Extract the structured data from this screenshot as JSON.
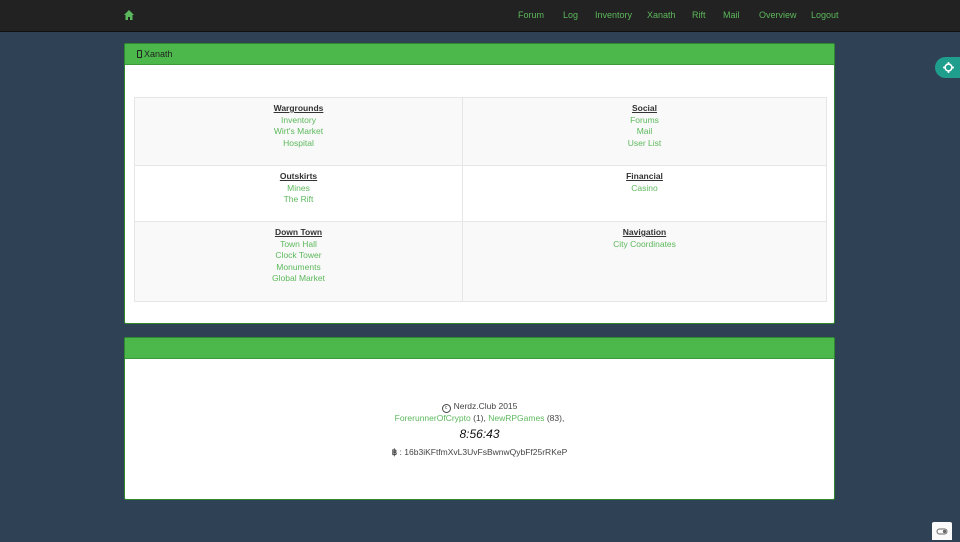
{
  "nav": {
    "home_icon": "home-icon",
    "links": [
      "Forum",
      "Log",
      "Inventory",
      "Xanath",
      "Rift",
      "Mail",
      "Overview",
      "Logout"
    ]
  },
  "panel1": {
    "title": "Xanath",
    "title_icon": "mobile-icon",
    "sections": [
      {
        "title": "Wargrounds",
        "links": [
          "Inventory",
          "Wirt's Market",
          "Hospital"
        ]
      },
      {
        "title": "Social",
        "links": [
          "Forums",
          "Mail",
          "User List"
        ]
      },
      {
        "title": "Outskirts",
        "links": [
          "Mines",
          "The Rift"
        ]
      },
      {
        "title": "Financial",
        "links": [
          "Casino"
        ]
      },
      {
        "title": "Down Town",
        "links": [
          "Town Hall",
          "Clock Tower",
          "Monuments",
          "Global Market"
        ]
      },
      {
        "title": "Navigation",
        "links": [
          "City Coordinates"
        ]
      }
    ]
  },
  "footer": {
    "copyright_icon": "copyright-icon",
    "copyright": "Nerdz.Club 2015",
    "users": [
      {
        "name": "ForerunnerOfCrypto",
        "count": "(1),"
      },
      {
        "name": "NewRPGames",
        "count": "(83),"
      }
    ],
    "clock": "8:56:43",
    "btc_icon": "bitcoin-icon",
    "btc_symbol": "฿",
    "btc_separator": ":",
    "btc_address": "16b3iKFtfmXvL3UvFsBwnwQybFf25rRKeP"
  },
  "colors": {
    "link": "#5cb85c",
    "panel_heading": "#4cb84c",
    "navbar": "#222222",
    "background": "#2e4155",
    "settings_tab": "#1f9e8e"
  }
}
